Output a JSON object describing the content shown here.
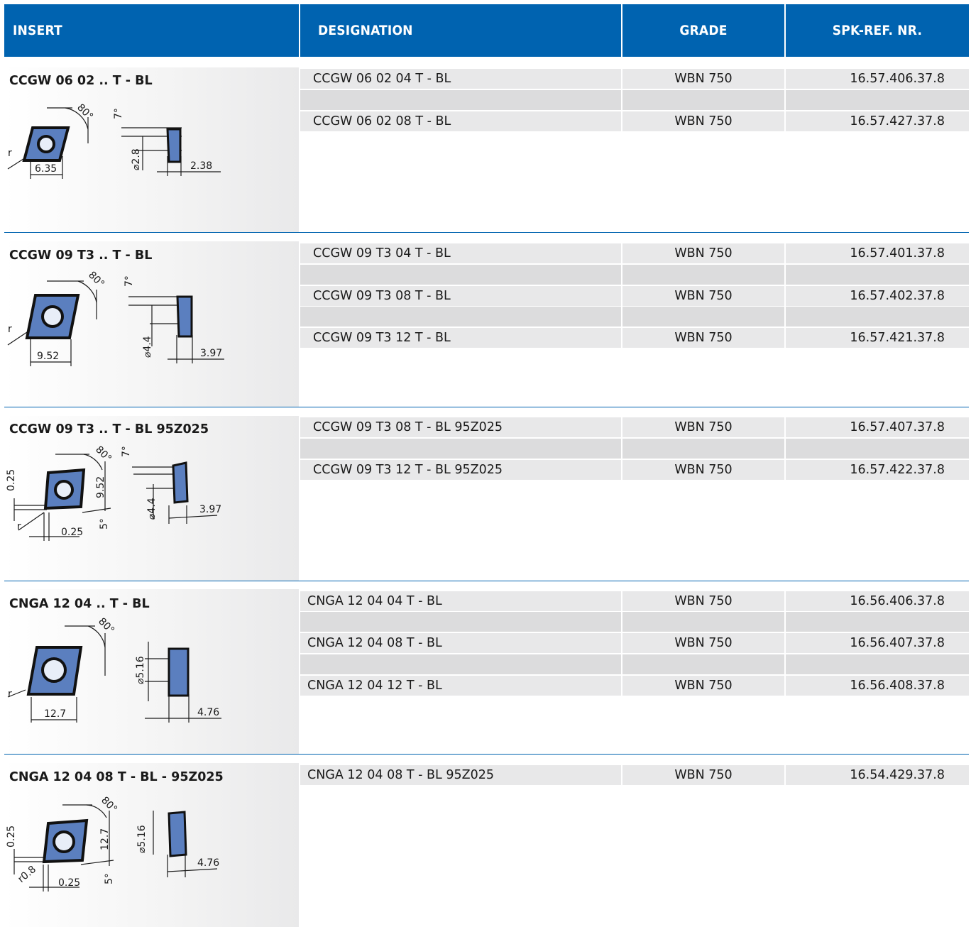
{
  "header": {
    "insert": "INSERT",
    "designation": "DESIGNATION",
    "grade": "GRADE",
    "ref": "SPK-REF. NR."
  },
  "sections": [
    {
      "title": "CCGW 06 02 ..  T - BL",
      "dims": {
        "angle": "80°",
        "rake": "7°",
        "hole": "⌀2.8",
        "width": "6.35",
        "thick": "2.38",
        "r": "r"
      },
      "rows": [
        {
          "designation": "CCGW 06 02 04 T - BL",
          "grade": "WBN 750",
          "ref": "16.57.406.37.8"
        },
        {
          "designation": "",
          "grade": "",
          "ref": ""
        },
        {
          "designation": "CCGW 06 02 08 T - BL",
          "grade": "WBN 750",
          "ref": "16.57.427.37.8"
        }
      ]
    },
    {
      "title": "CCGW 09 T3 .. T - BL",
      "dims": {
        "angle": "80°",
        "rake": "7°",
        "hole": "⌀4.4",
        "width": "9.52",
        "thick": "3.97",
        "r": "r"
      },
      "rows": [
        {
          "designation": "CCGW 09 T3 04 T - BL",
          "grade": "WBN 750",
          "ref": "16.57.401.37.8"
        },
        {
          "designation": "",
          "grade": "",
          "ref": ""
        },
        {
          "designation": "CCGW 09 T3 08 T - BL",
          "grade": "WBN 750",
          "ref": "16.57.402.37.8"
        },
        {
          "designation": "",
          "grade": "",
          "ref": ""
        },
        {
          "designation": "CCGW 09 T3 12 T - BL",
          "grade": "WBN 750",
          "ref": "16.57.421.37.8"
        }
      ]
    },
    {
      "title": "CCGW 09 T3 ..  T - BL 95Z025",
      "dims": {
        "angle": "80°",
        "rake": "7°",
        "hole": "⌀4.4",
        "width": "9.52",
        "thick": "3.97",
        "r": "r",
        "chamfer_h": "0.25",
        "chamfer_w": "0.25",
        "lead": "5°"
      },
      "rows": [
        {
          "designation": "CCGW 09 T3 08 T - BL 95Z025",
          "grade": "WBN 750",
          "ref": "16.57.407.37.8"
        },
        {
          "designation": "",
          "grade": "",
          "ref": ""
        },
        {
          "designation": "CCGW 09 T3 12 T - BL 95Z025",
          "grade": "WBN 750",
          "ref": "16.57.422.37.8"
        }
      ]
    },
    {
      "title": "CNGA 12 04 .. T - BL",
      "dims": {
        "angle": "80°",
        "hole": "⌀5.16",
        "width": "12.7",
        "thick": "4.76",
        "r": "r"
      },
      "rows": [
        {
          "designation": "CNGA 12 04 04 T - BL",
          "grade": "WBN 750",
          "ref": "16.56.406.37.8"
        },
        {
          "designation": "",
          "grade": "",
          "ref": ""
        },
        {
          "designation": "CNGA 12 04 08 T - BL",
          "grade": "WBN 750",
          "ref": "16.56.407.37.8"
        },
        {
          "designation": "",
          "grade": "",
          "ref": ""
        },
        {
          "designation": "CNGA 12 04 12 T - BL",
          "grade": "WBN 750",
          "ref": "16.56.408.37.8"
        }
      ]
    },
    {
      "title": "CNGA 12 04 08 T - BL - 95Z025",
      "dims": {
        "angle": "80°",
        "hole": "⌀5.16",
        "width": "12.7",
        "thick": "4.76",
        "r": "r0.8",
        "chamfer_h": "0.25",
        "chamfer_w": "0.25",
        "lead": "5°"
      },
      "rows": [
        {
          "designation": "CNGA 12 04 08 T - BL 95Z025",
          "grade": "WBN 750",
          "ref": "16.54.429.37.8"
        }
      ]
    }
  ]
}
